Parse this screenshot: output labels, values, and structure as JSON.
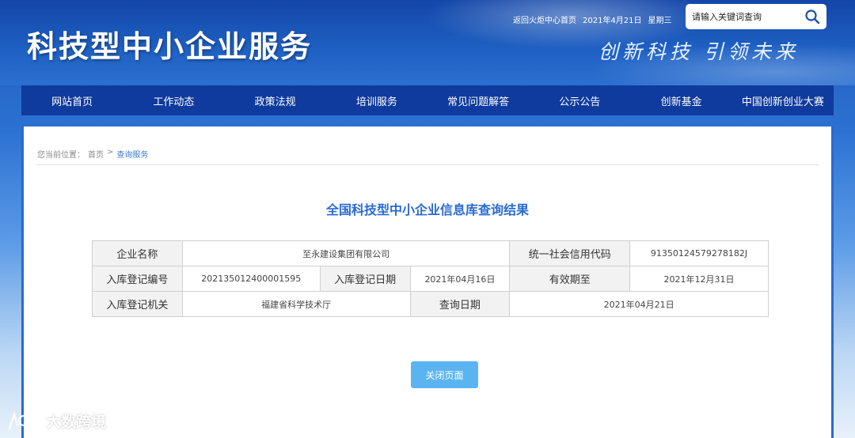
{
  "header": {
    "site_title": "科技型中小企业服务",
    "slogan": "创新科技 引领未来",
    "home_link": "返回火炬中心首页",
    "date": "2021年4月21日",
    "weekday": "星期三",
    "search_placeholder": "请输入关键词查询"
  },
  "nav": {
    "items": [
      "网站首页",
      "工作动态",
      "政策法规",
      "培训服务",
      "常见问题解答",
      "公示公告",
      "创新基金",
      "中国创新创业大赛"
    ]
  },
  "breadcrumb": {
    "prefix": "您当前位置：",
    "home": "首页",
    "sep": ">",
    "current": "查询服务"
  },
  "result": {
    "title": "全国科技型中小企业信息库查询结果",
    "labels": {
      "company_name": "企业名称",
      "credit_code": "统一社会信用代码",
      "reg_no": "入库登记编号",
      "reg_date": "入库登记日期",
      "valid_until": "有效期至",
      "reg_authority": "入库登记机关",
      "query_date": "查询日期"
    },
    "values": {
      "company_name": "至永建设集团有限公司",
      "credit_code": "91350124579278182J",
      "reg_no": "202135012400001595",
      "reg_date": "2021年04月16日",
      "valid_until": "2021年12月31日",
      "reg_authority": "福建省科学技术厅",
      "query_date": "2021年04月21日"
    },
    "close_button": "关闭页面"
  },
  "watermark": {
    "text": "大数跨境"
  },
  "colors": {
    "nav_bg": "#0f3a9e",
    "accent": "#2a6ad0",
    "button": "#5bb4f2"
  }
}
